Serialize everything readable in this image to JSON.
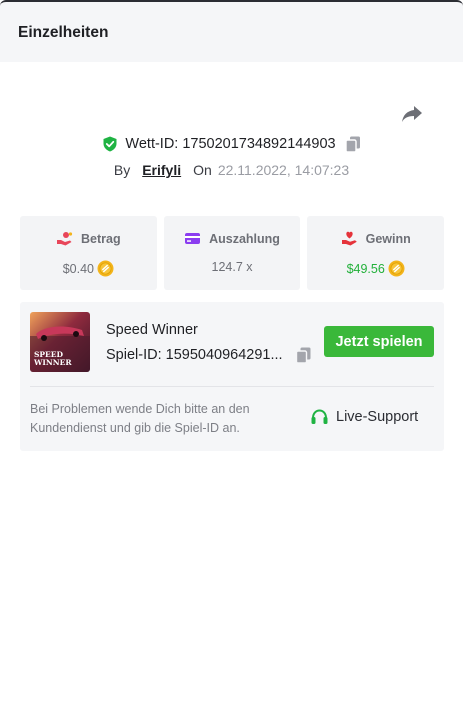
{
  "header": {
    "title": "Einzelheiten"
  },
  "bet": {
    "id_text": "Wett-ID: 1750201734892144903",
    "by_label": "By",
    "user": "Erifyli",
    "on_label": "On",
    "date": "22.11.2022, 14:07:23"
  },
  "stats": [
    {
      "label": "Betrag",
      "value": "$0.40",
      "icon": "hand-coins-icon",
      "coin": true
    },
    {
      "label": "Auszahlung",
      "value": "124.7 x",
      "icon": "credit-card-icon",
      "coin": false
    },
    {
      "label": "Gewinn",
      "value": "$49.56",
      "icon": "hand-heart-icon",
      "coin": true
    }
  ],
  "game": {
    "thumb_line1": "SPEED",
    "thumb_line2": "WINNER",
    "name": "Speed Winner",
    "id_text": "Spiel-ID: 1595040964291...",
    "play_label": "Jetzt spielen",
    "help_text": "Bei Problemen wende Dich bitte an den Kundendienst und gib die Spiel-ID an.",
    "support_label": "Live-Support"
  },
  "colors": {
    "accent_green": "#3ab83a",
    "win_green": "#22b03a",
    "betrag_red": "#e8465a",
    "auszahlung_purple": "#8b3df0",
    "gewinn_red": "#e5333b",
    "coin_gold": "#f3b41b"
  }
}
